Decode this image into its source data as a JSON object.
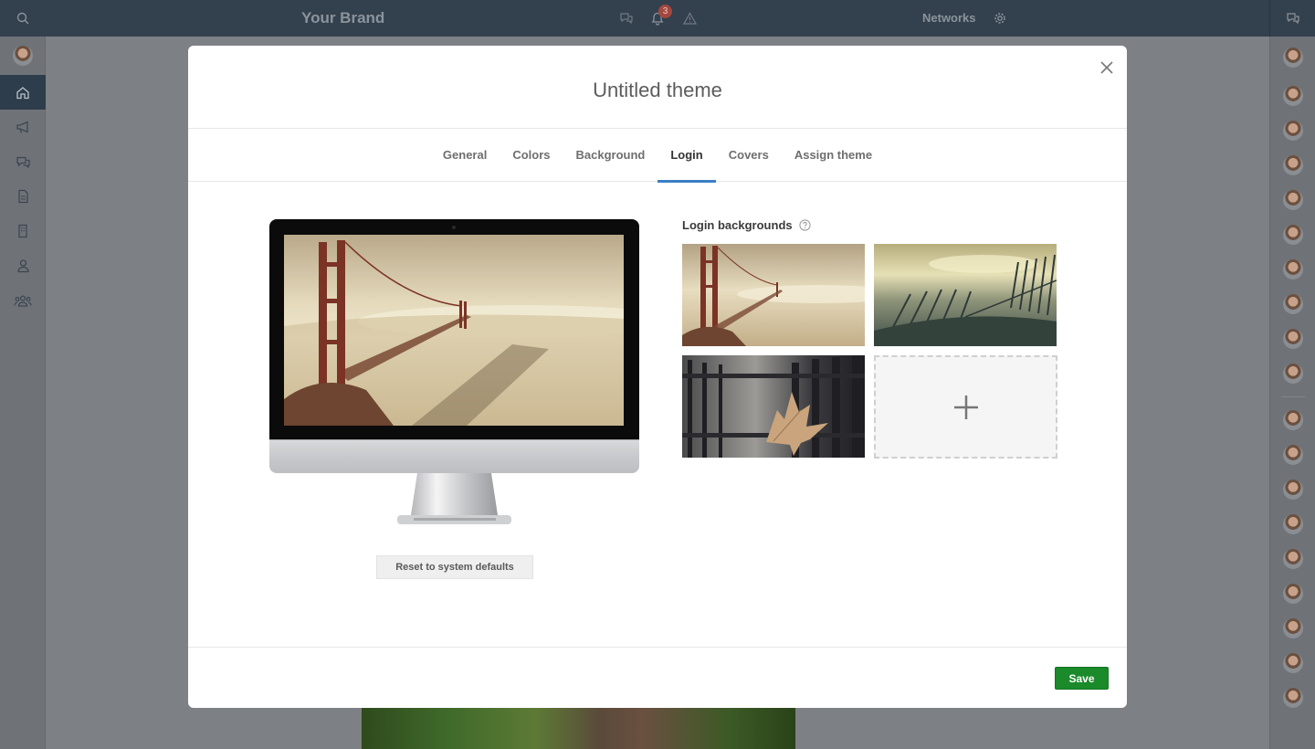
{
  "topbar": {
    "brand": "Your Brand",
    "notification_count": "3",
    "networks_label": "Networks"
  },
  "leftnav": {
    "items": [
      "home-icon",
      "megaphone-icon",
      "chat-icon",
      "document-icon",
      "building-icon",
      "person-icon",
      "group-icon"
    ],
    "active": "home-icon"
  },
  "modal": {
    "title": "Untitled theme",
    "tabs": [
      {
        "label": "General"
      },
      {
        "label": "Colors"
      },
      {
        "label": "Background"
      },
      {
        "label": "Login"
      },
      {
        "label": "Covers"
      },
      {
        "label": "Assign theme"
      }
    ],
    "active_tab": "Login",
    "reset_label": "Reset to system defaults",
    "login_backgrounds_title": "Login backgrounds",
    "add_symbol": "+",
    "save_label": "Save"
  },
  "colors": {
    "accent_tab": "#3b7fc4",
    "save": "#1a8a2a",
    "topbar": "#33404d"
  }
}
